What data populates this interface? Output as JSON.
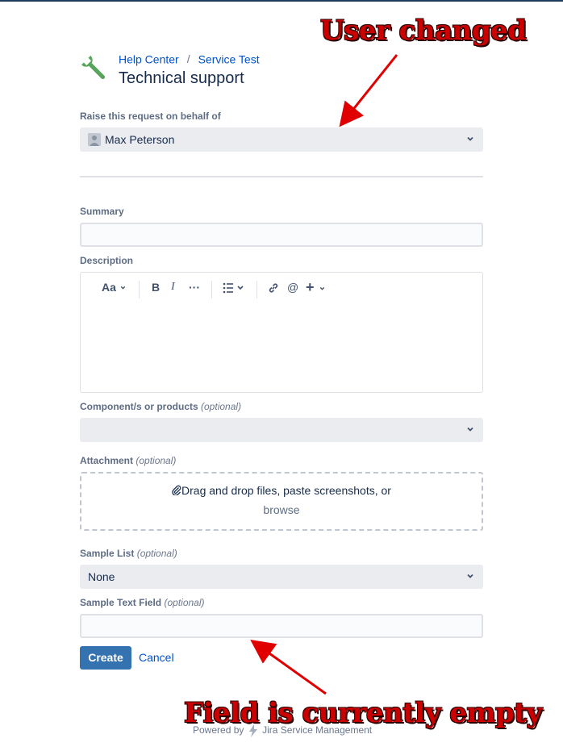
{
  "breadcrumb": {
    "home": "Help Center",
    "separator": "/",
    "project": "Service Test"
  },
  "page_title": "Technical support",
  "on_behalf": {
    "label": "Raise this request on behalf of",
    "value": "Max Peterson"
  },
  "summary": {
    "label": "Summary",
    "value": ""
  },
  "description": {
    "label": "Description",
    "toolbar": {
      "text_style": "Aa",
      "bold": "B",
      "italic": "I",
      "more": "···",
      "mention": "@",
      "insert": "+"
    }
  },
  "components": {
    "label": "Component/s or products",
    "optional": "(optional)",
    "value": ""
  },
  "attachment": {
    "label": "Attachment",
    "optional": "(optional)",
    "drop_text": "Drag and drop files, paste screenshots, or",
    "browse": "browse"
  },
  "sample_list": {
    "label": "Sample List",
    "optional": "(optional)",
    "value": "None"
  },
  "sample_text": {
    "label": "Sample Text Field",
    "optional": "(optional)",
    "value": ""
  },
  "actions": {
    "create": "Create",
    "cancel": "Cancel"
  },
  "annotations": {
    "top": "User changed",
    "bottom": "Field is currently empty"
  },
  "footer": {
    "powered_by": "Powered by",
    "product": "Jira Service Management"
  },
  "colors": {
    "link": "#0052cc",
    "primary": "#3572b0",
    "annotation": "#cc0000",
    "logo": "#57a55a"
  },
  "icons": [
    "wrench-icon",
    "chevron-down-icon",
    "user-avatar-icon",
    "paperclip-icon",
    "link-icon",
    "list-icon",
    "jira-bolt-icon"
  ]
}
